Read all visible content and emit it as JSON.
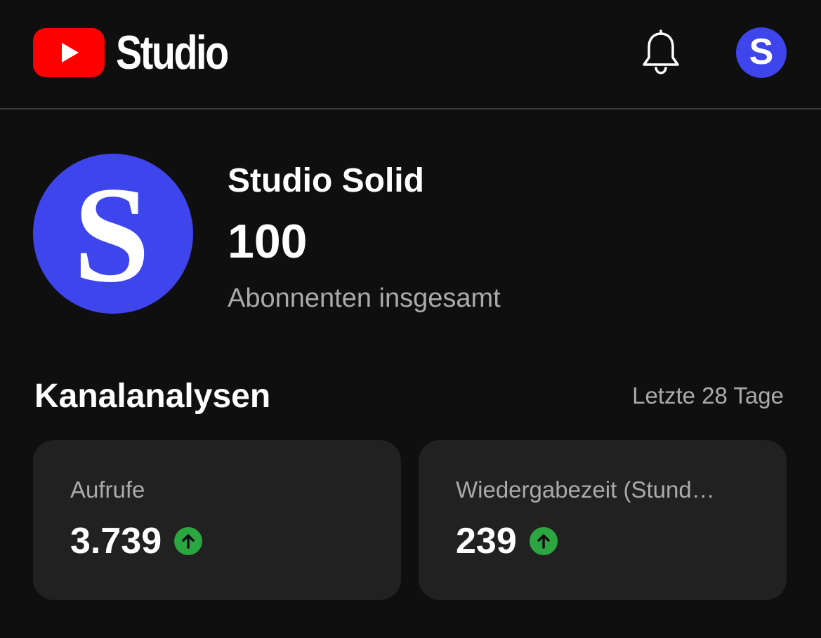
{
  "header": {
    "logo_text": "Studio",
    "icons": {
      "logo": "youtube-play-icon",
      "notifications": "bell-icon",
      "account": "account-avatar"
    },
    "avatar_letter": "S"
  },
  "channel": {
    "avatar_letter": "S",
    "name": "Studio Solid",
    "subscribers": "100",
    "subscribers_label": "Abonnenten insgesamt"
  },
  "analytics": {
    "title": "Kanalanalysen",
    "period": "Letzte 28 Tage",
    "cards": [
      {
        "label": "Aufrufe",
        "value": "3.739",
        "trend": "up",
        "trend_icon": "arrow-up-icon"
      },
      {
        "label": "Wiedergabezeit (Stund…",
        "value": "239",
        "trend": "up",
        "trend_icon": "arrow-up-icon"
      }
    ]
  },
  "colors": {
    "background": "#0f0f0f",
    "card": "#212121",
    "youtube_red": "#ff0000",
    "avatar_blue": "#3e45ec",
    "trend_green": "#2ba640",
    "secondary_text": "#aaaaaa"
  }
}
